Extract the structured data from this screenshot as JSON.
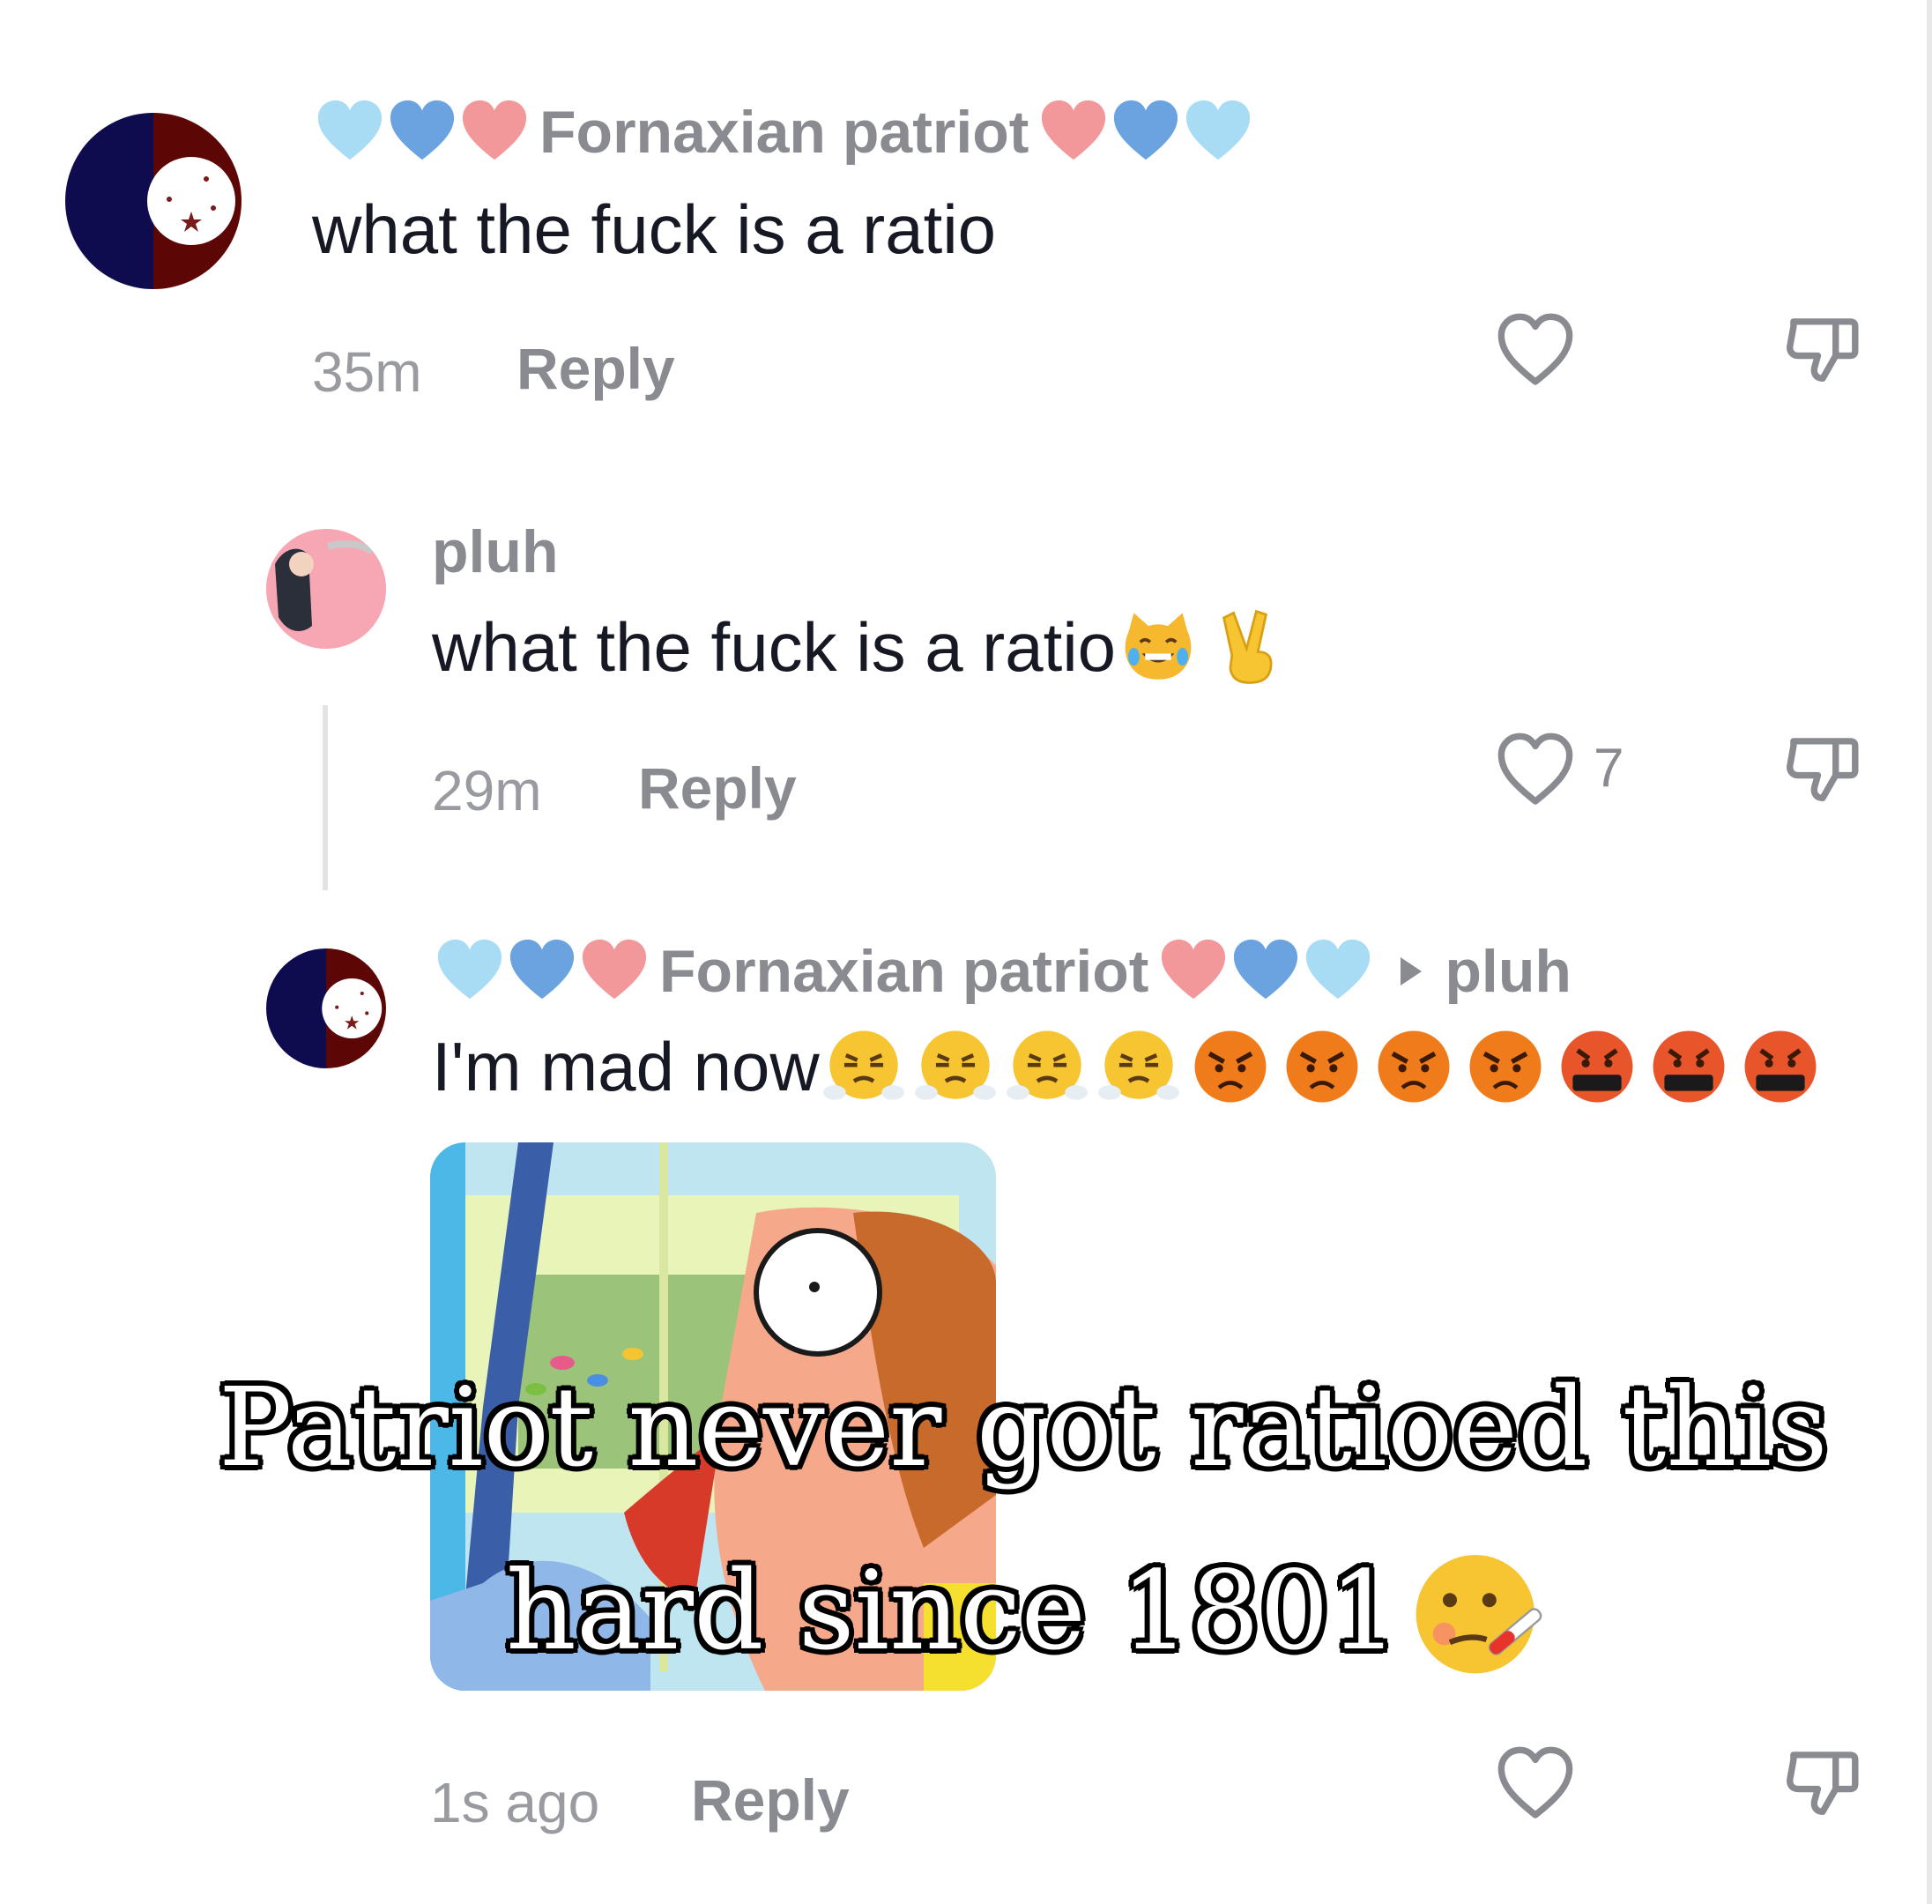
{
  "comments": [
    {
      "username": "Fornaxian patriot",
      "text": "what the fuck is a ratio",
      "time": "35m",
      "reply_label": "Reply",
      "like_count": ""
    },
    {
      "username": "pluh",
      "text": "what the fuck is a ratio",
      "time": "29m",
      "reply_label": "Reply",
      "like_count": "7"
    },
    {
      "username": "Fornaxian patriot",
      "reply_to": "pluh",
      "text": "I'm mad now",
      "time": "1s ago",
      "reply_label": "Reply",
      "like_count": ""
    }
  ],
  "overlay_caption": {
    "line1": "Patriot never got ratioed this",
    "line2": "hard since 1801"
  },
  "icons": {
    "like": "heart-outline-icon",
    "dislike": "thumbs-down-icon",
    "reply_arrow": "triangle-right-icon"
  },
  "colors": {
    "text": "#161823",
    "muted": "#8a8b91",
    "light_blue_heart": "#a8dcf5",
    "blue_heart": "#6aa3e0",
    "pink_heart": "#f2989a"
  }
}
